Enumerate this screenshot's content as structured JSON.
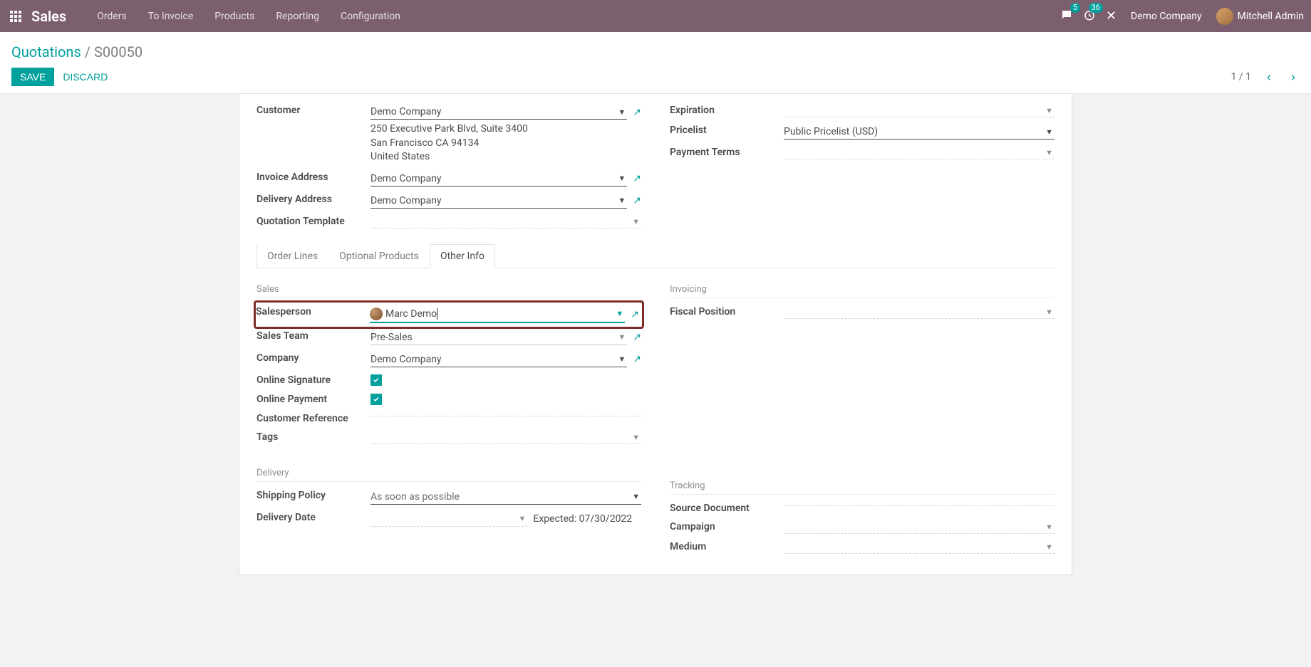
{
  "topbar": {
    "brand": "Sales",
    "nav": {
      "orders": "Orders",
      "to_invoice": "To Invoice",
      "products": "Products",
      "reporting": "Reporting",
      "configuration": "Configuration"
    },
    "chat_badge": "5",
    "timer_badge": "36",
    "company": "Demo Company",
    "user": "Mitchell Admin"
  },
  "breadcrumb": {
    "root": "Quotations",
    "current": "S00050"
  },
  "buttons": {
    "save": "SAVE",
    "discard": "DISCARD"
  },
  "pager": {
    "text": "1 / 1"
  },
  "fields": {
    "left": {
      "customer_label": "Customer",
      "customer_value": "Demo Company",
      "customer_addr_l1": "250 Executive Park Blvd, Suite 3400",
      "customer_addr_l2": "San Francisco CA 94134",
      "customer_addr_l3": "United States",
      "invoice_label": "Invoice Address",
      "invoice_value": "Demo Company",
      "delivery_label": "Delivery Address",
      "delivery_value": "Demo Company",
      "quote_tmpl_label": "Quotation Template",
      "quote_tmpl_value": ""
    },
    "right": {
      "expiration_label": "Expiration",
      "expiration_value": "",
      "pricelist_label": "Pricelist",
      "pricelist_value": "Public Pricelist (USD)",
      "payment_terms_label": "Payment Terms",
      "payment_terms_value": ""
    }
  },
  "tabs": {
    "order_lines": "Order Lines",
    "optional_products": "Optional Products",
    "other_info": "Other Info"
  },
  "sections": {
    "sales": {
      "header": "Sales",
      "salesperson_label": "Salesperson",
      "salesperson_value": "Marc Demo",
      "sales_team_label": "Sales Team",
      "sales_team_value": "Pre-Sales",
      "company_label": "Company",
      "company_value": "Demo Company",
      "online_sig_label": "Online Signature",
      "online_pay_label": "Online Payment",
      "cust_ref_label": "Customer Reference",
      "cust_ref_value": "",
      "tags_label": "Tags",
      "tags_value": ""
    },
    "invoicing": {
      "header": "Invoicing",
      "fiscal_label": "Fiscal Position",
      "fiscal_value": ""
    },
    "delivery": {
      "header": "Delivery",
      "ship_policy_label": "Shipping Policy",
      "ship_policy_value": "As soon as possible",
      "delivery_date_label": "Delivery Date",
      "delivery_date_expected": "Expected: 07/30/2022"
    },
    "tracking": {
      "header": "Tracking",
      "source_doc_label": "Source Document",
      "source_doc_value": "",
      "campaign_label": "Campaign",
      "campaign_value": "",
      "medium_label": "Medium",
      "medium_value": ""
    }
  }
}
